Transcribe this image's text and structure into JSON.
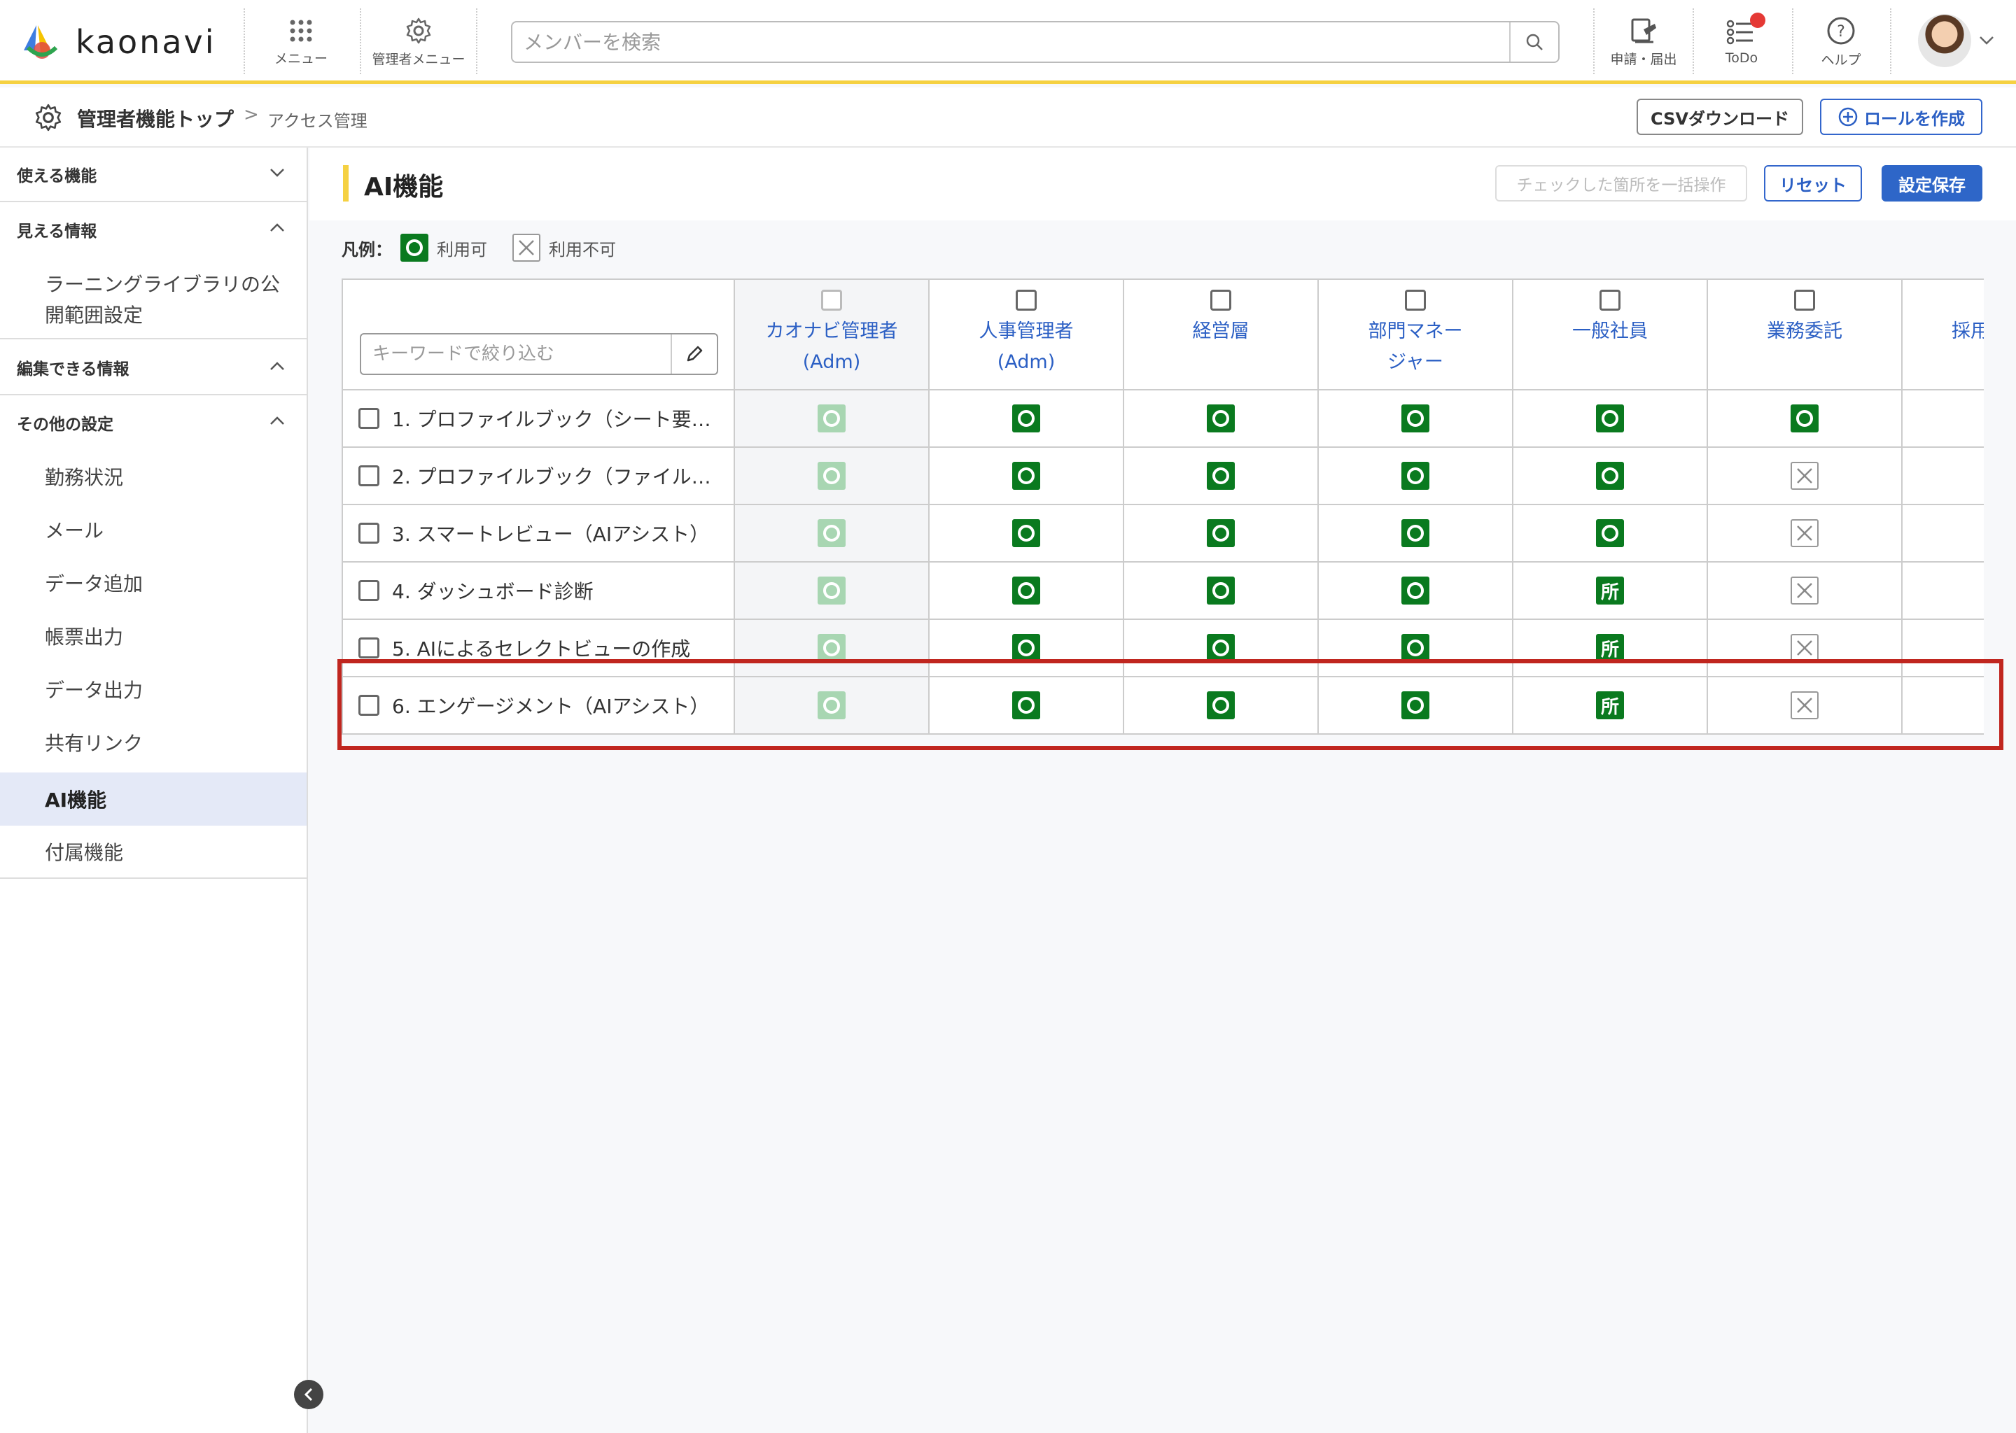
{
  "header": {
    "logo_text": "kaonavi",
    "menu_label": "メニュー",
    "admin_menu_label": "管理者メニュー",
    "search_placeholder": "メンバーを検索",
    "request_label": "申請・届出",
    "todo_label": "ToDo",
    "help_label": "ヘルプ"
  },
  "breadcrumb": {
    "top": "管理者機能トップ",
    "separator": ">",
    "current": "アクセス管理"
  },
  "actions": {
    "csv_download": "CSVダウンロード",
    "create_role": "ロールを作成"
  },
  "sidebar": {
    "sections": [
      {
        "label": "使える機能",
        "expanded": false
      },
      {
        "label": "見える情報",
        "expanded": true,
        "items": [
          "ラーニングライブラリの公",
          "開範囲設定"
        ]
      },
      {
        "label": "編集できる情報",
        "expanded": true
      },
      {
        "label": "その他の設定",
        "expanded": true
      }
    ],
    "other_items": [
      "勤務状況",
      "メール",
      "データ追加",
      "帳票出力",
      "データ出力",
      "共有リンク",
      "AI機能",
      "付属機能"
    ],
    "active_item": "AI機能"
  },
  "main": {
    "title": "AI機能",
    "bulk_action_label": "チェックした箇所を一括操作",
    "reset_label": "リセット",
    "save_label": "設定保存",
    "legend_label": "凡例：",
    "legend_available": "利用可",
    "legend_unavailable": "利用不可",
    "filter_placeholder": "キーワードで絞り込む"
  },
  "table": {
    "roles": [
      {
        "line1": "カオナビ管理者",
        "line2": "(Adm)"
      },
      {
        "line1": "人事管理者",
        "line2": "(Adm)"
      },
      {
        "line1": "経営層",
        "line2": ""
      },
      {
        "line1": "部門マネー",
        "line2": "ジャー"
      },
      {
        "line1": "一般社員",
        "line2": ""
      },
      {
        "line1": "業務委託",
        "line2": ""
      },
      {
        "line1": "採用",
        "line2": ""
      }
    ],
    "rows": [
      {
        "label": "1. プロファイルブック（シート要…",
        "cells": [
          "ok-faded",
          "ok",
          "ok",
          "ok",
          "ok",
          "ok",
          ""
        ]
      },
      {
        "label": "2. プロファイルブック（ファイル…",
        "cells": [
          "ok-faded",
          "ok",
          "ok",
          "ok",
          "ok",
          "ng",
          ""
        ]
      },
      {
        "label": "3. スマートレビュー（AIアシスト）",
        "cells": [
          "ok-faded",
          "ok",
          "ok",
          "ok",
          "ok",
          "ng",
          ""
        ]
      },
      {
        "label": "4. ダッシュボード診断",
        "cells": [
          "ok-faded",
          "ok",
          "ok",
          "ok",
          "sho",
          "ng",
          "pm"
        ]
      },
      {
        "label": "5. AIによるセレクトビューの作成",
        "cells": [
          "ok-faded",
          "ok",
          "ok",
          "ok",
          "sho",
          "ng",
          ""
        ]
      },
      {
        "label": "6. エンゲージメント（AIアシスト）",
        "cells": [
          "ok-faded",
          "ok",
          "ok",
          "ok",
          "sho",
          "ng",
          ""
        ]
      }
    ],
    "sho_glyph": "所",
    "pm_glyph": "±"
  },
  "colors": {
    "accent_yellow": "#f5d142",
    "brand_blue": "#2e66c8",
    "ok_green": "#0a7a1f",
    "highlight_red": "#c0261f"
  }
}
